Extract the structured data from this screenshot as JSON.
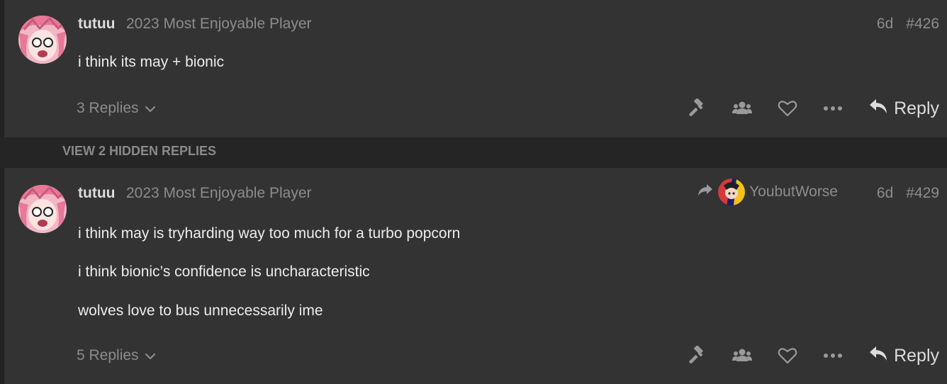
{
  "posts": [
    {
      "username": "tutuu",
      "user_title": "2023 Most Enjoyable Player",
      "age": "6d",
      "post_number": "#426",
      "body": [
        "i think its may + bionic"
      ],
      "replies_label": "3 Replies",
      "reply_label": "Reply"
    },
    {
      "username": "tutuu",
      "user_title": "2023 Most Enjoyable Player",
      "reply_to_user": "YoubutWorse",
      "age": "6d",
      "post_number": "#429",
      "body": [
        "i think may is tryharding way too much for a turbo popcorn",
        "i think bionic’s confidence is uncharacteristic",
        "wolves love to bus unnecessarily ime"
      ],
      "replies_label": "5 Replies",
      "reply_label": "Reply"
    }
  ],
  "hidden_replies_label": "VIEW 2 HIDDEN REPLIES",
  "icons": {
    "gavel": "gavel-icon",
    "users": "users-icon",
    "like": "heart-icon",
    "more": "ellipsis-icon",
    "reply": "reply-arrow-icon",
    "expand": "chevron-down-icon",
    "reply_to": "share-arrow-icon"
  },
  "colors": {
    "post_bg": "#333333",
    "page_bg": "#222222",
    "muted_text": "#8c8c8c",
    "text": "#ececec"
  }
}
